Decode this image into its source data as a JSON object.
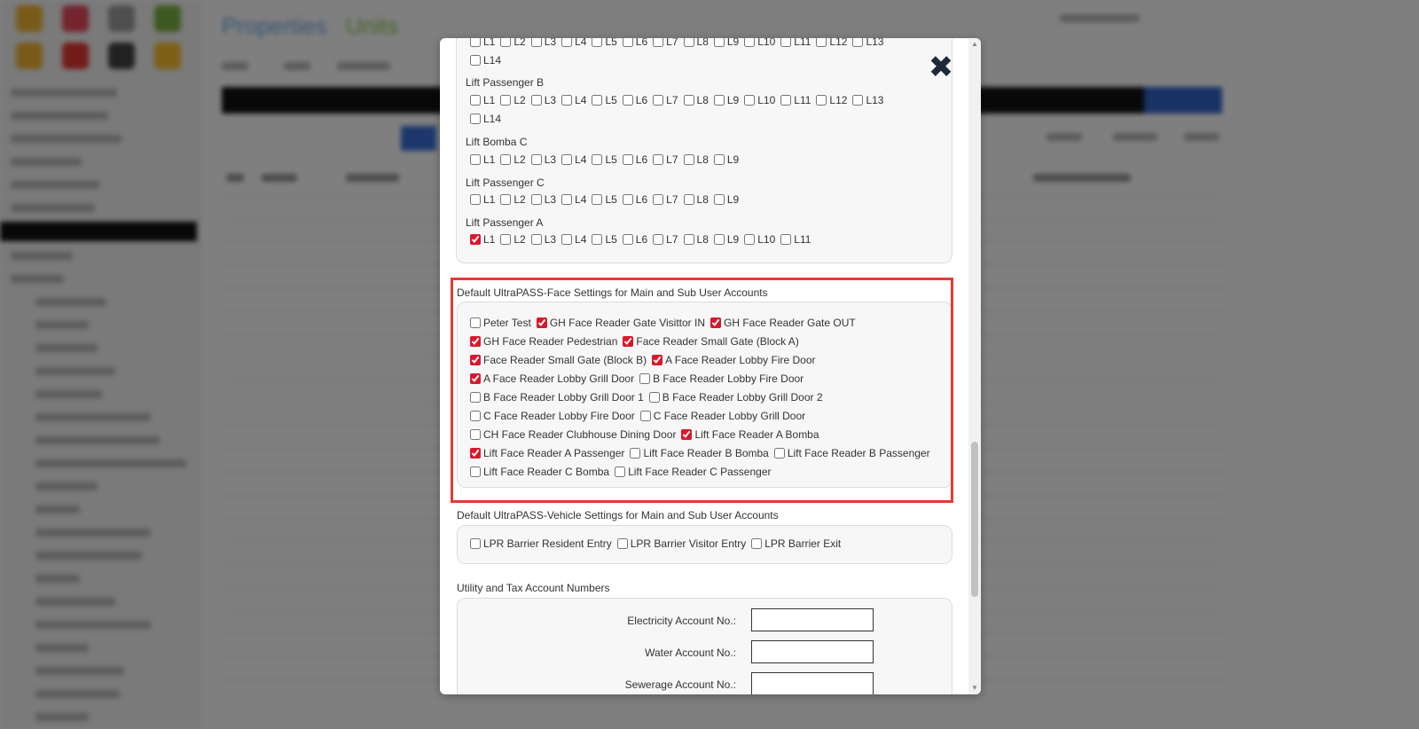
{
  "background": {
    "app_title": "Properties",
    "app_subtitle": "Units"
  },
  "modal": {
    "top_partial_row": [
      "L1",
      "L2",
      "L3",
      "L4",
      "L5",
      "L6",
      "L7",
      "L8",
      "L9",
      "L10",
      "L11",
      "L12",
      "L13",
      "L14"
    ],
    "lift_groups": [
      {
        "label": "Lift Passenger B",
        "levels": [
          "L1",
          "L2",
          "L3",
          "L4",
          "L5",
          "L6",
          "L7",
          "L8",
          "L9",
          "L10",
          "L11",
          "L12",
          "L13",
          "L14"
        ],
        "checked": []
      },
      {
        "label": "Lift Bomba C",
        "levels": [
          "L1",
          "L2",
          "L3",
          "L4",
          "L5",
          "L6",
          "L7",
          "L8",
          "L9"
        ],
        "checked": []
      },
      {
        "label": "Lift Passenger C",
        "levels": [
          "L1",
          "L2",
          "L3",
          "L4",
          "L5",
          "L6",
          "L7",
          "L8",
          "L9"
        ],
        "checked": []
      },
      {
        "label": "Lift Passenger A",
        "levels": [
          "L1",
          "L2",
          "L3",
          "L4",
          "L5",
          "L6",
          "L7",
          "L8",
          "L9",
          "L10",
          "L11"
        ],
        "checked": [
          "L1"
        ]
      }
    ],
    "face_section": {
      "title": "Default UltraPASS-Face Settings for Main and Sub User Accounts",
      "rows": [
        [
          {
            "label": "Peter Test",
            "checked": false
          },
          {
            "label": "GH Face Reader Gate Visittor IN",
            "checked": true
          },
          {
            "label": "GH Face Reader Gate OUT",
            "checked": true
          }
        ],
        [
          {
            "label": "GH Face Reader Pedestrian",
            "checked": true
          },
          {
            "label": "Face Reader Small Gate (Block A)",
            "checked": true
          }
        ],
        [
          {
            "label": "Face Reader Small Gate (Block B)",
            "checked": true
          },
          {
            "label": "A Face Reader Lobby Fire Door",
            "checked": true
          }
        ],
        [
          {
            "label": "A Face Reader Lobby Grill Door",
            "checked": true
          },
          {
            "label": "B Face Reader Lobby Fire Door",
            "checked": false
          }
        ],
        [
          {
            "label": "B Face Reader Lobby Grill Door 1",
            "checked": false
          },
          {
            "label": "B Face Reader Lobby Grill Door 2",
            "checked": false
          }
        ],
        [
          {
            "label": "C Face Reader Lobby Fire Door",
            "checked": false
          },
          {
            "label": "C Face Reader Lobby Grill Door",
            "checked": false
          }
        ],
        [
          {
            "label": "CH Face Reader Clubhouse Dining Door",
            "checked": false
          },
          {
            "label": "Lift Face Reader A Bomba",
            "checked": true
          }
        ],
        [
          {
            "label": "Lift Face Reader A Passenger",
            "checked": true
          },
          {
            "label": "Lift Face Reader B Bomba",
            "checked": false
          },
          {
            "label": "Lift Face Reader B Passenger",
            "checked": false
          }
        ],
        [
          {
            "label": "Lift Face Reader C Bomba",
            "checked": false
          },
          {
            "label": "Lift Face Reader C Passenger",
            "checked": false
          }
        ]
      ]
    },
    "vehicle_section": {
      "title": "Default UltraPASS-Vehicle Settings for Main and Sub User Accounts",
      "items": [
        {
          "label": "LPR Barrier Resident Entry",
          "checked": false
        },
        {
          "label": "LPR Barrier Visitor Entry",
          "checked": false
        },
        {
          "label": "LPR Barrier Exit",
          "checked": false
        }
      ]
    },
    "utility_section": {
      "title": "Utility and Tax Account Numbers",
      "fields": [
        {
          "label": "Electricity Account No.:",
          "value": ""
        },
        {
          "label": "Water Account No.:",
          "value": ""
        },
        {
          "label": "Sewerage Account No.:",
          "value": ""
        }
      ]
    },
    "colors": {
      "highlight": "#e53935",
      "checkbox_accent": "#d9182d"
    }
  }
}
